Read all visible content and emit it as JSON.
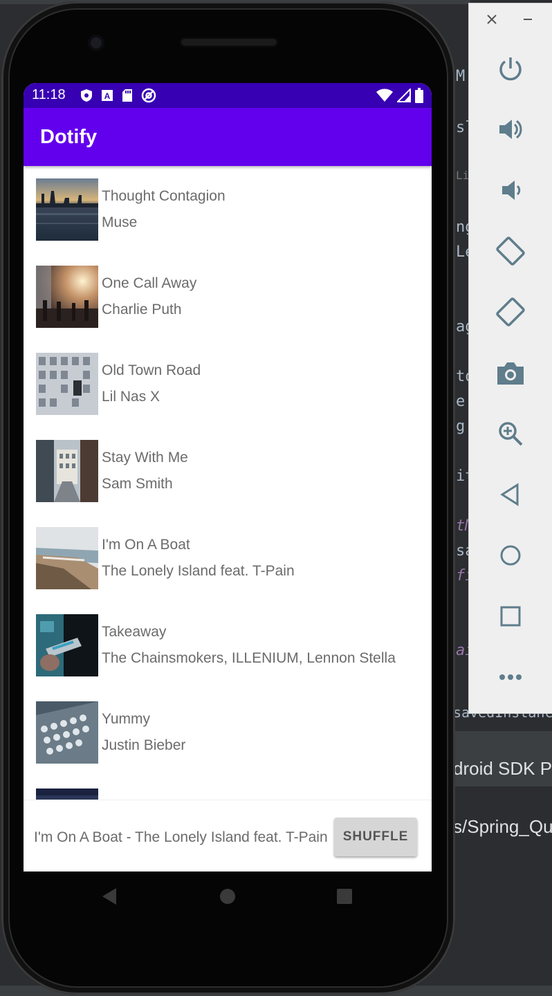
{
  "status_bar": {
    "time": "11:18",
    "icons": [
      "shield-icon",
      "font-a-icon",
      "sd-card-icon",
      "at-sign-icon"
    ],
    "right_icons": [
      "wifi-icon",
      "signal-icon",
      "battery-icon"
    ]
  },
  "app": {
    "title": "Dotify",
    "primary_color": "#6200ee",
    "status_color": "#3700b3"
  },
  "songs": [
    {
      "title": "Thought Contagion",
      "artist": "Muse"
    },
    {
      "title": "One Call Away",
      "artist": "Charlie Puth"
    },
    {
      "title": "Old Town Road",
      "artist": "Lil Nas X"
    },
    {
      "title": "Stay With Me",
      "artist": "Sam Smith"
    },
    {
      "title": "I'm On A Boat",
      "artist": "The Lonely Island feat. T-Pain"
    },
    {
      "title": "Takeaway",
      "artist": "The Chainsmokers, ILLENIUM, Lennon Stella"
    },
    {
      "title": "Yummy",
      "artist": "Justin Bieber"
    }
  ],
  "mini_player": {
    "now_playing": "I'm On A Boat - The Lonely Island feat. T-Pain",
    "shuffle_label": "SHUFFLE"
  },
  "nav": [
    "back-icon",
    "home-icon",
    "recents-icon"
  ],
  "emulator_panel": {
    "buttons": [
      "power-icon",
      "volume-up-icon",
      "volume-down-icon",
      "rotate-left-icon",
      "rotate-right-icon",
      "camera-icon",
      "zoom-icon",
      "back-icon",
      "home-icon",
      "overview-icon",
      "more-icon"
    ]
  },
  "ide_fragments": {
    "line1": "M",
    "line2": "sl",
    "line3": "Lis",
    "line4": "ng",
    "line5": "Le",
    "line6": "ag",
    "line7": "to",
    "line8": "e",
    "line9": "g",
    "line10": "it",
    "line11": "tM",
    "line12": "sa",
    "line13": "fi",
    "line14": "ai",
    "line15": "savedInstanc",
    "line16": "droid SDK P",
    "line17": "s/Spring_Qu"
  }
}
